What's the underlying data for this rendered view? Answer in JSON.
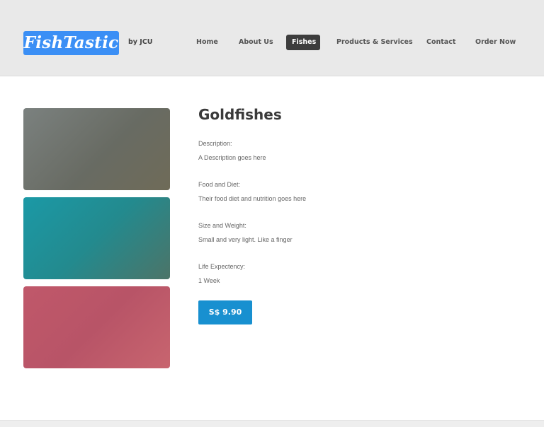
{
  "header": {
    "logo_text": "FishTastic",
    "byline": "by JCU"
  },
  "nav": {
    "items": [
      {
        "label": "Home",
        "active": false
      },
      {
        "label": "About Us",
        "active": false
      },
      {
        "label": "Fishes",
        "active": true
      },
      {
        "label": "Products & Services",
        "active": false
      },
      {
        "label": "Contact",
        "active": false
      },
      {
        "label": "Order Now",
        "active": false
      }
    ]
  },
  "product": {
    "title": "Goldfishes",
    "details": [
      {
        "label": "Description:",
        "value": "A Description goes here"
      },
      {
        "label": "Food and Diet:",
        "value": "Their food diet and nutrition goes here"
      },
      {
        "label": "Size and Weight:",
        "value": "Small and very light. Like a finger"
      },
      {
        "label": "Life Expectency:",
        "value": "1 Week"
      }
    ],
    "price": "S$ 9.90"
  },
  "colors": {
    "logo_bg": "#3b8ff5",
    "nav_active_bg": "#3d3d3d",
    "price_button_bg": "#1890d0",
    "header_bg": "#e9e9e9"
  }
}
